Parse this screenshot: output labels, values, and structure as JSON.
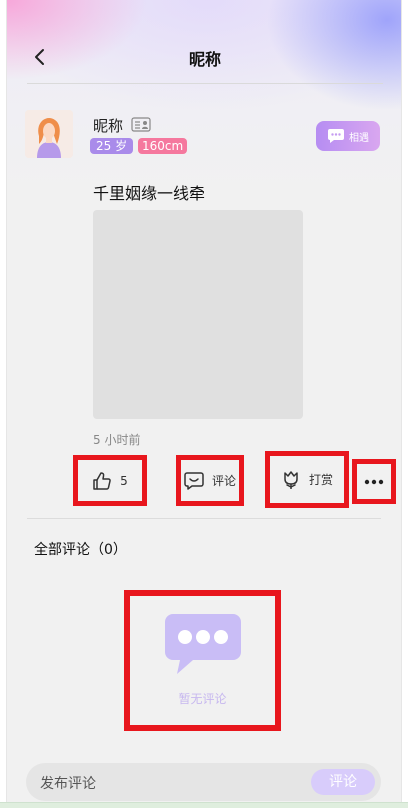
{
  "header": {
    "title": "昵称"
  },
  "profile": {
    "nickname": "昵称",
    "age": "25 岁",
    "height": "160cm",
    "meet_label": "相遇"
  },
  "post": {
    "text": "千里姻缘一线牵",
    "time": "5 小时前"
  },
  "actions": {
    "like_count": "5",
    "comment_label": "评论",
    "reward_label": "打赏"
  },
  "comments": {
    "header": "全部评论（0）",
    "empty_text": "暂无评论"
  },
  "composer": {
    "placeholder": "发布评论",
    "submit_label": "评论"
  },
  "colors": {
    "accent_purple": "#a98bea",
    "pink": "#f5789e",
    "highlight_red": "#e8161d"
  },
  "icons": [
    "back-icon",
    "id-card-icon",
    "chat-bubble-icon",
    "thumbs-up-icon",
    "comment-icon",
    "gift-flower-icon",
    "more-icon",
    "empty-comment-icon"
  ]
}
